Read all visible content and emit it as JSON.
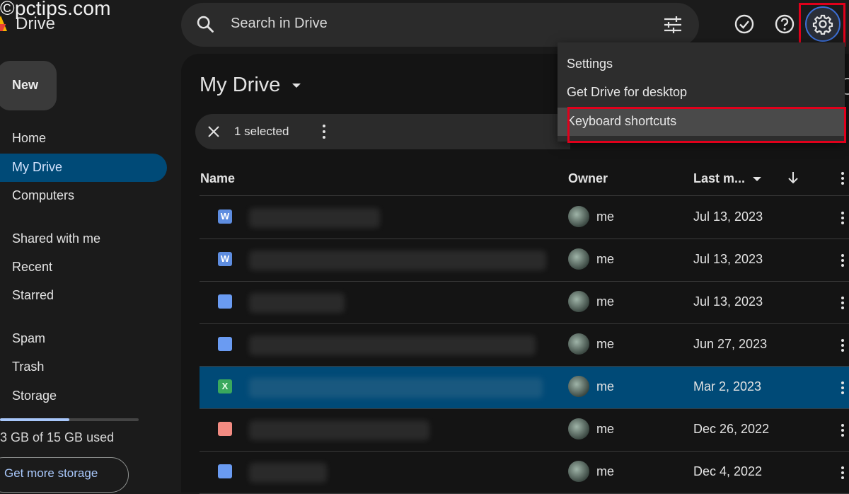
{
  "watermark": "©pctips.com",
  "app": {
    "name": "Drive"
  },
  "search": {
    "placeholder": "Search in Drive"
  },
  "sidebar": {
    "new_label": "New",
    "items": [
      {
        "label": "Home"
      },
      {
        "label": "My Drive",
        "active": true
      },
      {
        "label": "Computers"
      },
      {
        "label": "Shared with me"
      },
      {
        "label": "Recent"
      },
      {
        "label": "Starred"
      },
      {
        "label": "Spam"
      },
      {
        "label": "Trash"
      },
      {
        "label": "Storage"
      }
    ],
    "storage_used": "3 GB of 15 GB used",
    "storage_fraction": 0.5,
    "get_more_storage": "Get more storage"
  },
  "main": {
    "title": "My Drive",
    "selection": {
      "text": "1 selected"
    },
    "columns": {
      "name": "Name",
      "owner": "Owner",
      "modified": "Last m..."
    },
    "rows": [
      {
        "icon": "word-file-icon",
        "icon_text": "W",
        "owner": "me",
        "modified": "Jul 13, 2023",
        "selected": false
      },
      {
        "icon": "word-file-icon",
        "icon_text": "W",
        "owner": "me",
        "modified": "Jul 13, 2023",
        "selected": false
      },
      {
        "icon": "google-doc-icon",
        "icon_text": "",
        "owner": "me",
        "modified": "Jul 13, 2023",
        "selected": false
      },
      {
        "icon": "google-doc-icon",
        "icon_text": "",
        "owner": "me",
        "modified": "Jun 27, 2023",
        "selected": false
      },
      {
        "icon": "excel-file-icon",
        "icon_text": "X",
        "owner": "me",
        "modified": "Mar 2, 2023",
        "selected": true
      },
      {
        "icon": "video-file-icon",
        "icon_text": "",
        "owner": "me",
        "modified": "Dec 26, 2022",
        "selected": false
      },
      {
        "icon": "google-doc-icon",
        "icon_text": "",
        "owner": "me",
        "modified": "Dec 4, 2022",
        "selected": false
      }
    ]
  },
  "settings_menu": {
    "items": [
      {
        "label": "Settings"
      },
      {
        "label": "Get Drive for desktop"
      },
      {
        "label": "Keyboard shortcuts",
        "highlighted": true
      }
    ]
  },
  "colors": {
    "accent_selected": "#004a77",
    "annotation_red": "#e0001b",
    "focus_ring": "#3c6fd6"
  }
}
